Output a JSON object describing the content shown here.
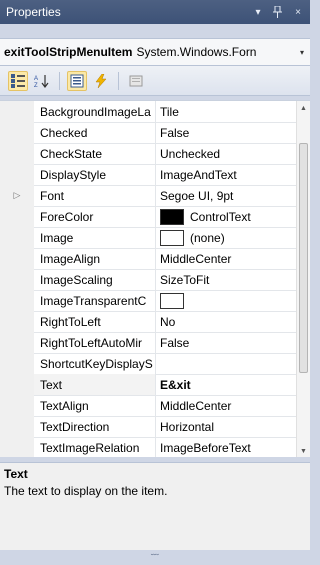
{
  "window": {
    "title": "Properties",
    "pin_glyph": "2  ",
    "dropdown_glyph": "▾",
    "pin_icon_glyph": "p",
    "close_glyph": "×"
  },
  "object_selector": {
    "name": "exitToolStripMenuItem",
    "type": "System.Windows.Forn",
    "arrow_glyph": "▾"
  },
  "toolbar": {
    "buttons": [
      {
        "name": "categorized-button",
        "active": true
      },
      {
        "name": "alphabetical-button",
        "active": false
      },
      {
        "name": "properties-button",
        "active": true
      },
      {
        "name": "events-button",
        "active": false
      },
      {
        "name": "property-pages-button",
        "active": false
      }
    ]
  },
  "properties": [
    {
      "name": "BackgroundImageLa",
      "value": "Tile"
    },
    {
      "name": "Checked",
      "value": "False"
    },
    {
      "name": "CheckState",
      "value": "Unchecked"
    },
    {
      "name": "DisplayStyle",
      "value": "ImageAndText"
    },
    {
      "name": "Font",
      "value": "Segoe UI, 9pt",
      "expand": "▷"
    },
    {
      "name": "ForeColor",
      "value": "ControlText",
      "swatch": "#000000"
    },
    {
      "name": "Image",
      "value": "(none)",
      "swatch": "#ffffff"
    },
    {
      "name": "ImageAlign",
      "value": "MiddleCenter"
    },
    {
      "name": "ImageScaling",
      "value": "SizeToFit"
    },
    {
      "name": "ImageTransparentC",
      "value": "",
      "swatch": "#ffffff"
    },
    {
      "name": "RightToLeft",
      "value": "No"
    },
    {
      "name": "RightToLeftAutoMir",
      "value": "False"
    },
    {
      "name": "ShortcutKeyDisplayS",
      "value": ""
    },
    {
      "name": "Text",
      "value": "E&xit",
      "selected": true
    },
    {
      "name": "TextAlign",
      "value": "MiddleCenter"
    },
    {
      "name": "TextDirection",
      "value": "Horizontal"
    },
    {
      "name": "TextImageRelation",
      "value": "ImageBeforeText"
    }
  ],
  "description": {
    "title": "Text",
    "text": "The text to display on the item."
  },
  "colors": {
    "titlebar": "#3d5277",
    "selection_highlight": "#fbe9a8"
  }
}
